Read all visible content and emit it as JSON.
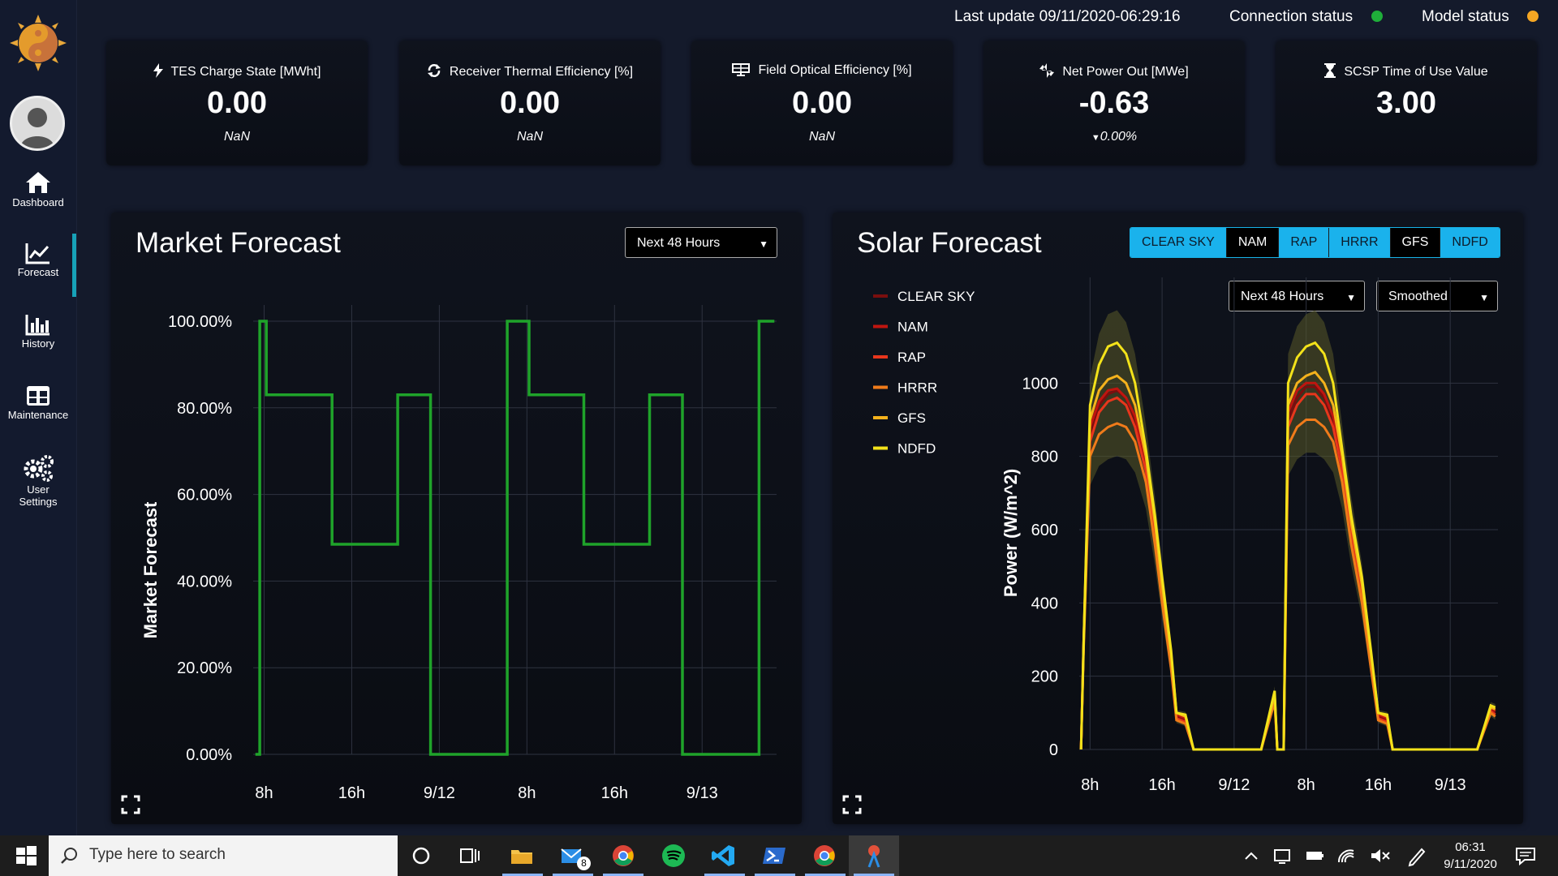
{
  "sidebar": {
    "items": [
      {
        "label": "Dashboard",
        "icon": "home-icon"
      },
      {
        "label": "Forecast",
        "icon": "line-chart-icon",
        "active": true
      },
      {
        "label": "History",
        "icon": "bar-chart-icon"
      },
      {
        "label": "Maintenance",
        "icon": "grid-icon"
      },
      {
        "label": "User\nSettings",
        "icon": "gears-icon"
      }
    ]
  },
  "status": {
    "last_update": "Last update 09/11/2020-06:29:16",
    "connection_label": "Connection status",
    "connection_color": "#1fae3a",
    "model_label": "Model status",
    "model_color": "#f5a623"
  },
  "kpis": [
    {
      "title": "TES Charge State [MWht]",
      "value": "0.00",
      "sub": "NaN",
      "icon": "bolt-icon"
    },
    {
      "title": "Receiver Thermal Efficiency [%]",
      "value": "0.00",
      "sub": "NaN",
      "icon": "cycle-icon"
    },
    {
      "title": "Field Optical Efficiency [%]",
      "value": "0.00",
      "sub": "NaN",
      "icon": "panel-icon"
    },
    {
      "title": "Net Power Out [MWe]",
      "value": "-0.63",
      "sub": "0.00%",
      "icon": "power-arrows-icon"
    },
    {
      "title": "SCSP Time of Use Value",
      "value": "3.00",
      "sub": "",
      "icon": "hourglass-icon"
    }
  ],
  "market": {
    "title": "Market Forecast",
    "range": "Next 48 Hours"
  },
  "solar": {
    "title": "Solar Forecast",
    "range": "Next 48 Hours",
    "mode": "Smoothed",
    "toggles": [
      {
        "label": "CLEAR SKY",
        "on": true
      },
      {
        "label": "NAM",
        "on": false
      },
      {
        "label": "RAP",
        "on": true
      },
      {
        "label": "HRRR",
        "on": true
      },
      {
        "label": "GFS",
        "on": false
      },
      {
        "label": "NDFD",
        "on": true
      }
    ]
  },
  "chart_data": [
    {
      "type": "line",
      "title": "Market Forecast",
      "ylabel": "Market Forecast",
      "xlabel": "",
      "ylim": [
        0,
        1
      ],
      "y_ticks": [
        "0.00%",
        "20.00%",
        "40.00%",
        "60.00%",
        "80.00%",
        "100.00%"
      ],
      "x_ticks": [
        "8h",
        "16h",
        "9/12",
        "8h",
        "16h",
        "9/13"
      ],
      "x_tick_hours": [
        8,
        16,
        24,
        32,
        40,
        48
      ],
      "grid": true,
      "color": "#1fa32a",
      "series": [
        {
          "x": [
            7.2,
            7.6,
            7.6,
            8.2,
            8.2,
            14.2,
            14.2,
            20.2,
            20.2,
            23.2,
            23.2,
            30.2,
            30.2,
            32.2,
            32.2,
            37.2,
            37.2,
            43.2,
            43.2,
            46.2,
            46.2,
            53.2,
            53.2,
            54.6
          ],
          "y": [
            0,
            0,
            1.0,
            1.0,
            0.83,
            0.83,
            0.485,
            0.485,
            0.83,
            0.83,
            0,
            0,
            1.0,
            1.0,
            0.83,
            0.83,
            0.485,
            0.485,
            0.83,
            0.83,
            0,
            0,
            1.0,
            1.0
          ]
        }
      ]
    },
    {
      "type": "line",
      "title": "Solar Forecast",
      "ylabel": "Power (W/m^2)",
      "xlabel": "",
      "ylim": [
        0,
        1200
      ],
      "y_ticks": [
        "0",
        "200",
        "400",
        "600",
        "800",
        "1000"
      ],
      "x_ticks": [
        "8h",
        "16h",
        "9/12",
        "8h",
        "16h",
        "9/13"
      ],
      "x_tick_hours": [
        8,
        16,
        24,
        32,
        40,
        48
      ],
      "grid": true,
      "legend": "left",
      "series": [
        {
          "name": "CLEAR SKY",
          "color": "#7a0e0e",
          "x": [
            7.0,
            7.3,
            8.0,
            9.0,
            10.0,
            11.0,
            12.0,
            13.0,
            14.2,
            15.2,
            16.0,
            17.0,
            17.6,
            18.6,
            19.5,
            23.0,
            27.0,
            28.5,
            28.8,
            29.5,
            30.0,
            31.0,
            32.0,
            33.0,
            34.0,
            35.0,
            36.0,
            37.0,
            38.2,
            39.2,
            40.0,
            41.0,
            41.6,
            42.6,
            43.5,
            47.0,
            51.0,
            52.5,
            53.0
          ],
          "y": [
            0,
            300,
            860,
            940,
            970,
            980,
            960,
            900,
            780,
            600,
            430,
            240,
            90,
            80,
            0,
            0,
            0,
            140,
            0,
            0,
            900,
            960,
            990,
            990,
            960,
            900,
            780,
            600,
            430,
            240,
            90,
            80,
            0,
            0,
            0,
            0,
            0,
            110,
            100
          ]
        },
        {
          "name": "NAM",
          "color": "#c0150f",
          "x": [
            7.0,
            7.3,
            8.0,
            9.0,
            10.0,
            11.0,
            12.0,
            13.0,
            14.2,
            15.2,
            16.0,
            17.0,
            17.6,
            18.6,
            19.5,
            23.0,
            27.0,
            28.5,
            28.8,
            29.5,
            30.0,
            31.0,
            32.0,
            33.0,
            34.0,
            35.0,
            36.0,
            37.0,
            38.2,
            39.2,
            40.0,
            41.0,
            41.6,
            42.6,
            43.5,
            47.0,
            51.0,
            52.5,
            53.0
          ],
          "y": [
            0,
            300,
            880,
            950,
            980,
            985,
            960,
            910,
            790,
            610,
            440,
            250,
            95,
            85,
            0,
            0,
            0,
            150,
            0,
            0,
            920,
            980,
            1000,
            1000,
            970,
            910,
            790,
            610,
            440,
            250,
            95,
            85,
            0,
            0,
            0,
            0,
            0,
            115,
            105
          ]
        },
        {
          "name": "RAP",
          "color": "#e8361c",
          "x": [
            7.0,
            7.3,
            8.0,
            9.0,
            10.0,
            11.0,
            12.0,
            13.0,
            14.2,
            15.2,
            16.0,
            17.0,
            17.6,
            18.6,
            19.5,
            23.0,
            27.0,
            28.5,
            28.8,
            29.5,
            30.0,
            31.0,
            32.0,
            33.0,
            34.0,
            35.0,
            36.0,
            37.0,
            38.2,
            39.2,
            40.0,
            41.0,
            41.6,
            42.6,
            43.5,
            47.0,
            51.0,
            52.5,
            53.0
          ],
          "y": [
            0,
            290,
            840,
            920,
            950,
            960,
            940,
            880,
            760,
            580,
            410,
            230,
            85,
            75,
            0,
            0,
            0,
            135,
            0,
            0,
            880,
            940,
            970,
            970,
            940,
            880,
            760,
            580,
            410,
            230,
            85,
            75,
            0,
            0,
            0,
            0,
            0,
            105,
            95
          ]
        },
        {
          "name": "HRRR",
          "color": "#f07b1a",
          "x": [
            7.0,
            7.3,
            8.0,
            9.0,
            10.0,
            11.0,
            12.0,
            13.0,
            14.2,
            15.2,
            16.0,
            17.0,
            17.6,
            18.6,
            19.5,
            23.0,
            27.0,
            28.5,
            28.8,
            29.5,
            30.0,
            31.0,
            32.0,
            33.0,
            34.0,
            35.0,
            36.0,
            37.0,
            38.2,
            39.2,
            40.0,
            41.0,
            41.6,
            42.6,
            43.5,
            47.0,
            51.0,
            52.5,
            53.0
          ],
          "y": [
            0,
            280,
            800,
            860,
            880,
            890,
            880,
            840,
            730,
            560,
            400,
            220,
            80,
            70,
            0,
            0,
            0,
            130,
            0,
            0,
            830,
            880,
            900,
            900,
            880,
            840,
            730,
            560,
            400,
            220,
            80,
            70,
            0,
            0,
            0,
            0,
            0,
            100,
            90
          ]
        },
        {
          "name": "GFS",
          "color": "#f5b21c",
          "x": [
            7.0,
            7.3,
            8.0,
            9.0,
            10.0,
            11.0,
            12.0,
            13.0,
            14.2,
            15.2,
            16.0,
            17.0,
            17.6,
            18.6,
            19.5,
            23.0,
            27.0,
            28.5,
            28.8,
            29.5,
            30.0,
            31.0,
            32.0,
            33.0,
            34.0,
            35.0,
            36.0,
            37.0,
            38.2,
            39.2,
            40.0,
            41.0,
            41.6,
            42.6,
            43.5,
            47.0,
            51.0,
            52.5,
            53.0
          ],
          "y": [
            0,
            300,
            900,
            980,
            1010,
            1020,
            1000,
            940,
            800,
            620,
            450,
            260,
            100,
            90,
            0,
            0,
            0,
            150,
            0,
            0,
            940,
            1000,
            1020,
            1030,
            1000,
            940,
            800,
            620,
            450,
            260,
            100,
            90,
            0,
            0,
            0,
            0,
            0,
            115,
            110
          ]
        },
        {
          "name": "NDFD",
          "color": "#f3e21a",
          "x": [
            7.0,
            7.3,
            8.0,
            9.0,
            10.0,
            11.0,
            12.0,
            13.0,
            14.2,
            15.2,
            16.0,
            17.0,
            17.6,
            18.6,
            19.5,
            23.0,
            27.0,
            28.5,
            28.8,
            29.5,
            30.0,
            31.0,
            32.0,
            33.0,
            34.0,
            35.0,
            36.0,
            37.0,
            38.2,
            39.2,
            40.0,
            41.0,
            41.6,
            42.6,
            43.5,
            47.0,
            51.0,
            52.5,
            53.0
          ],
          "y": [
            0,
            300,
            940,
            1050,
            1100,
            1110,
            1080,
            1000,
            820,
            640,
            470,
            270,
            100,
            95,
            0,
            0,
            0,
            160,
            0,
            0,
            1000,
            1070,
            1100,
            1110,
            1080,
            1000,
            820,
            640,
            470,
            270,
            100,
            95,
            0,
            0,
            0,
            0,
            0,
            120,
            115
          ]
        }
      ]
    }
  ],
  "taskbar": {
    "search_placeholder": "Type here to search",
    "mail_badge": "8",
    "time": "06:31",
    "date": "9/11/2020"
  }
}
